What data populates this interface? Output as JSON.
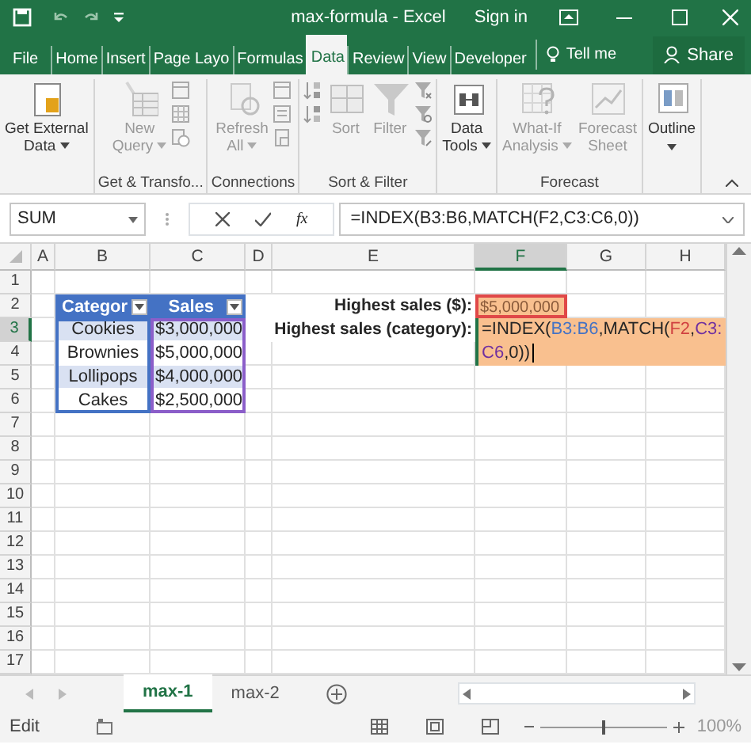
{
  "title_bar": {
    "title": "max-formula - Excel",
    "sign_in": "Sign in"
  },
  "tabs": [
    {
      "label": "File",
      "selected": false
    },
    {
      "label": "Home",
      "selected": false
    },
    {
      "label": "Insert",
      "selected": false
    },
    {
      "label": "Page Layo",
      "selected": false
    },
    {
      "label": "Formulas",
      "selected": false
    },
    {
      "label": "Data",
      "selected": true
    },
    {
      "label": "Review",
      "selected": false
    },
    {
      "label": "View",
      "selected": false
    },
    {
      "label": "Developer",
      "selected": false
    }
  ],
  "tell_me": "Tell me",
  "share": "Share",
  "ribbon": [
    {
      "buttons": [
        {
          "lines": [
            "Get External",
            "Data"
          ],
          "dropdown": true,
          "disabled": false
        }
      ]
    },
    {
      "label": "Get & Transfo...",
      "buttons": [
        {
          "lines": [
            "New",
            "Query"
          ],
          "dropdown": true,
          "disabled": true
        }
      ]
    },
    {
      "label": "Connections",
      "buttons": [
        {
          "lines": [
            "Refresh",
            "All"
          ],
          "dropdown": true,
          "disabled": true
        }
      ]
    },
    {
      "label": "Sort & Filter",
      "buttons": [
        {
          "lines": [
            "Sort"
          ],
          "dropdown": false,
          "disabled": true
        },
        {
          "lines": [
            "Filter"
          ],
          "dropdown": false,
          "disabled": true
        }
      ]
    },
    {
      "buttons": [
        {
          "lines": [
            "Data",
            "Tools"
          ],
          "dropdown": true,
          "disabled": false
        }
      ]
    },
    {
      "label": "Forecast",
      "buttons": [
        {
          "lines": [
            "What-If",
            "Analysis"
          ],
          "dropdown": true,
          "disabled": true
        },
        {
          "lines": [
            "Forecast",
            "Sheet"
          ],
          "dropdown": false,
          "disabled": true
        }
      ]
    },
    {
      "buttons": [
        {
          "lines": [
            "Outline"
          ],
          "dropdown": true,
          "disabled": false
        }
      ]
    }
  ],
  "formula_bar": {
    "name_box": "SUM",
    "function_label": "fx",
    "formula": "=INDEX(B3:B6,MATCH(F2,C3:C6,0))"
  },
  "columns": [
    {
      "label": "A",
      "selected": false
    },
    {
      "label": "B",
      "selected": false
    },
    {
      "label": "C",
      "selected": false
    },
    {
      "label": "D",
      "selected": false
    },
    {
      "label": "E",
      "selected": false
    },
    {
      "label": "F",
      "selected": true
    },
    {
      "label": "G",
      "selected": false
    },
    {
      "label": "H",
      "selected": false
    }
  ],
  "rows": [
    {
      "label": "1",
      "selected": false
    },
    {
      "label": "2",
      "selected": false
    },
    {
      "label": "3",
      "selected": true
    },
    {
      "label": "4",
      "selected": false
    },
    {
      "label": "5",
      "selected": false
    },
    {
      "label": "6",
      "selected": false
    },
    {
      "label": "7",
      "selected": false
    },
    {
      "label": "8",
      "selected": false
    },
    {
      "label": "9",
      "selected": false
    },
    {
      "label": "10",
      "selected": false
    },
    {
      "label": "11",
      "selected": false
    },
    {
      "label": "12",
      "selected": false
    },
    {
      "label": "13",
      "selected": false
    },
    {
      "label": "14",
      "selected": false
    },
    {
      "label": "15",
      "selected": false
    },
    {
      "label": "16",
      "selected": false
    },
    {
      "label": "17",
      "selected": false
    }
  ],
  "table": {
    "headers": [
      "Categor",
      "Sales"
    ],
    "rows": [
      [
        "Cookies",
        "$3,000,000"
      ],
      [
        "Brownies",
        "$5,000,000"
      ],
      [
        "Lollipops",
        "$4,000,000"
      ],
      [
        "Cakes",
        "$2,500,000"
      ]
    ]
  },
  "labels": [
    "Highest sales ($):",
    "Highest sales (category):"
  ],
  "result": "$5,000,000",
  "formula_parts": [
    {
      "text": "=INDEX(",
      "color": "#262626"
    },
    {
      "text": "B3:B6",
      "color": "#4472c4"
    },
    {
      "text": ",MATCH(",
      "color": "#262626"
    },
    {
      "text": "F2",
      "color": "#d04040"
    },
    {
      "text": ",",
      "color": "#262626"
    },
    {
      "text": "C3:C6",
      "color": "#7030a0"
    },
    {
      "text": ",0))",
      "color": "#262626"
    }
  ],
  "sheets": [
    {
      "label": "max-1",
      "selected": true
    },
    {
      "label": "max-2",
      "selected": false
    }
  ],
  "status": {
    "mode": "Edit",
    "zoom": "100%",
    "zoom_slider": {
      "level": 0.5
    }
  }
}
